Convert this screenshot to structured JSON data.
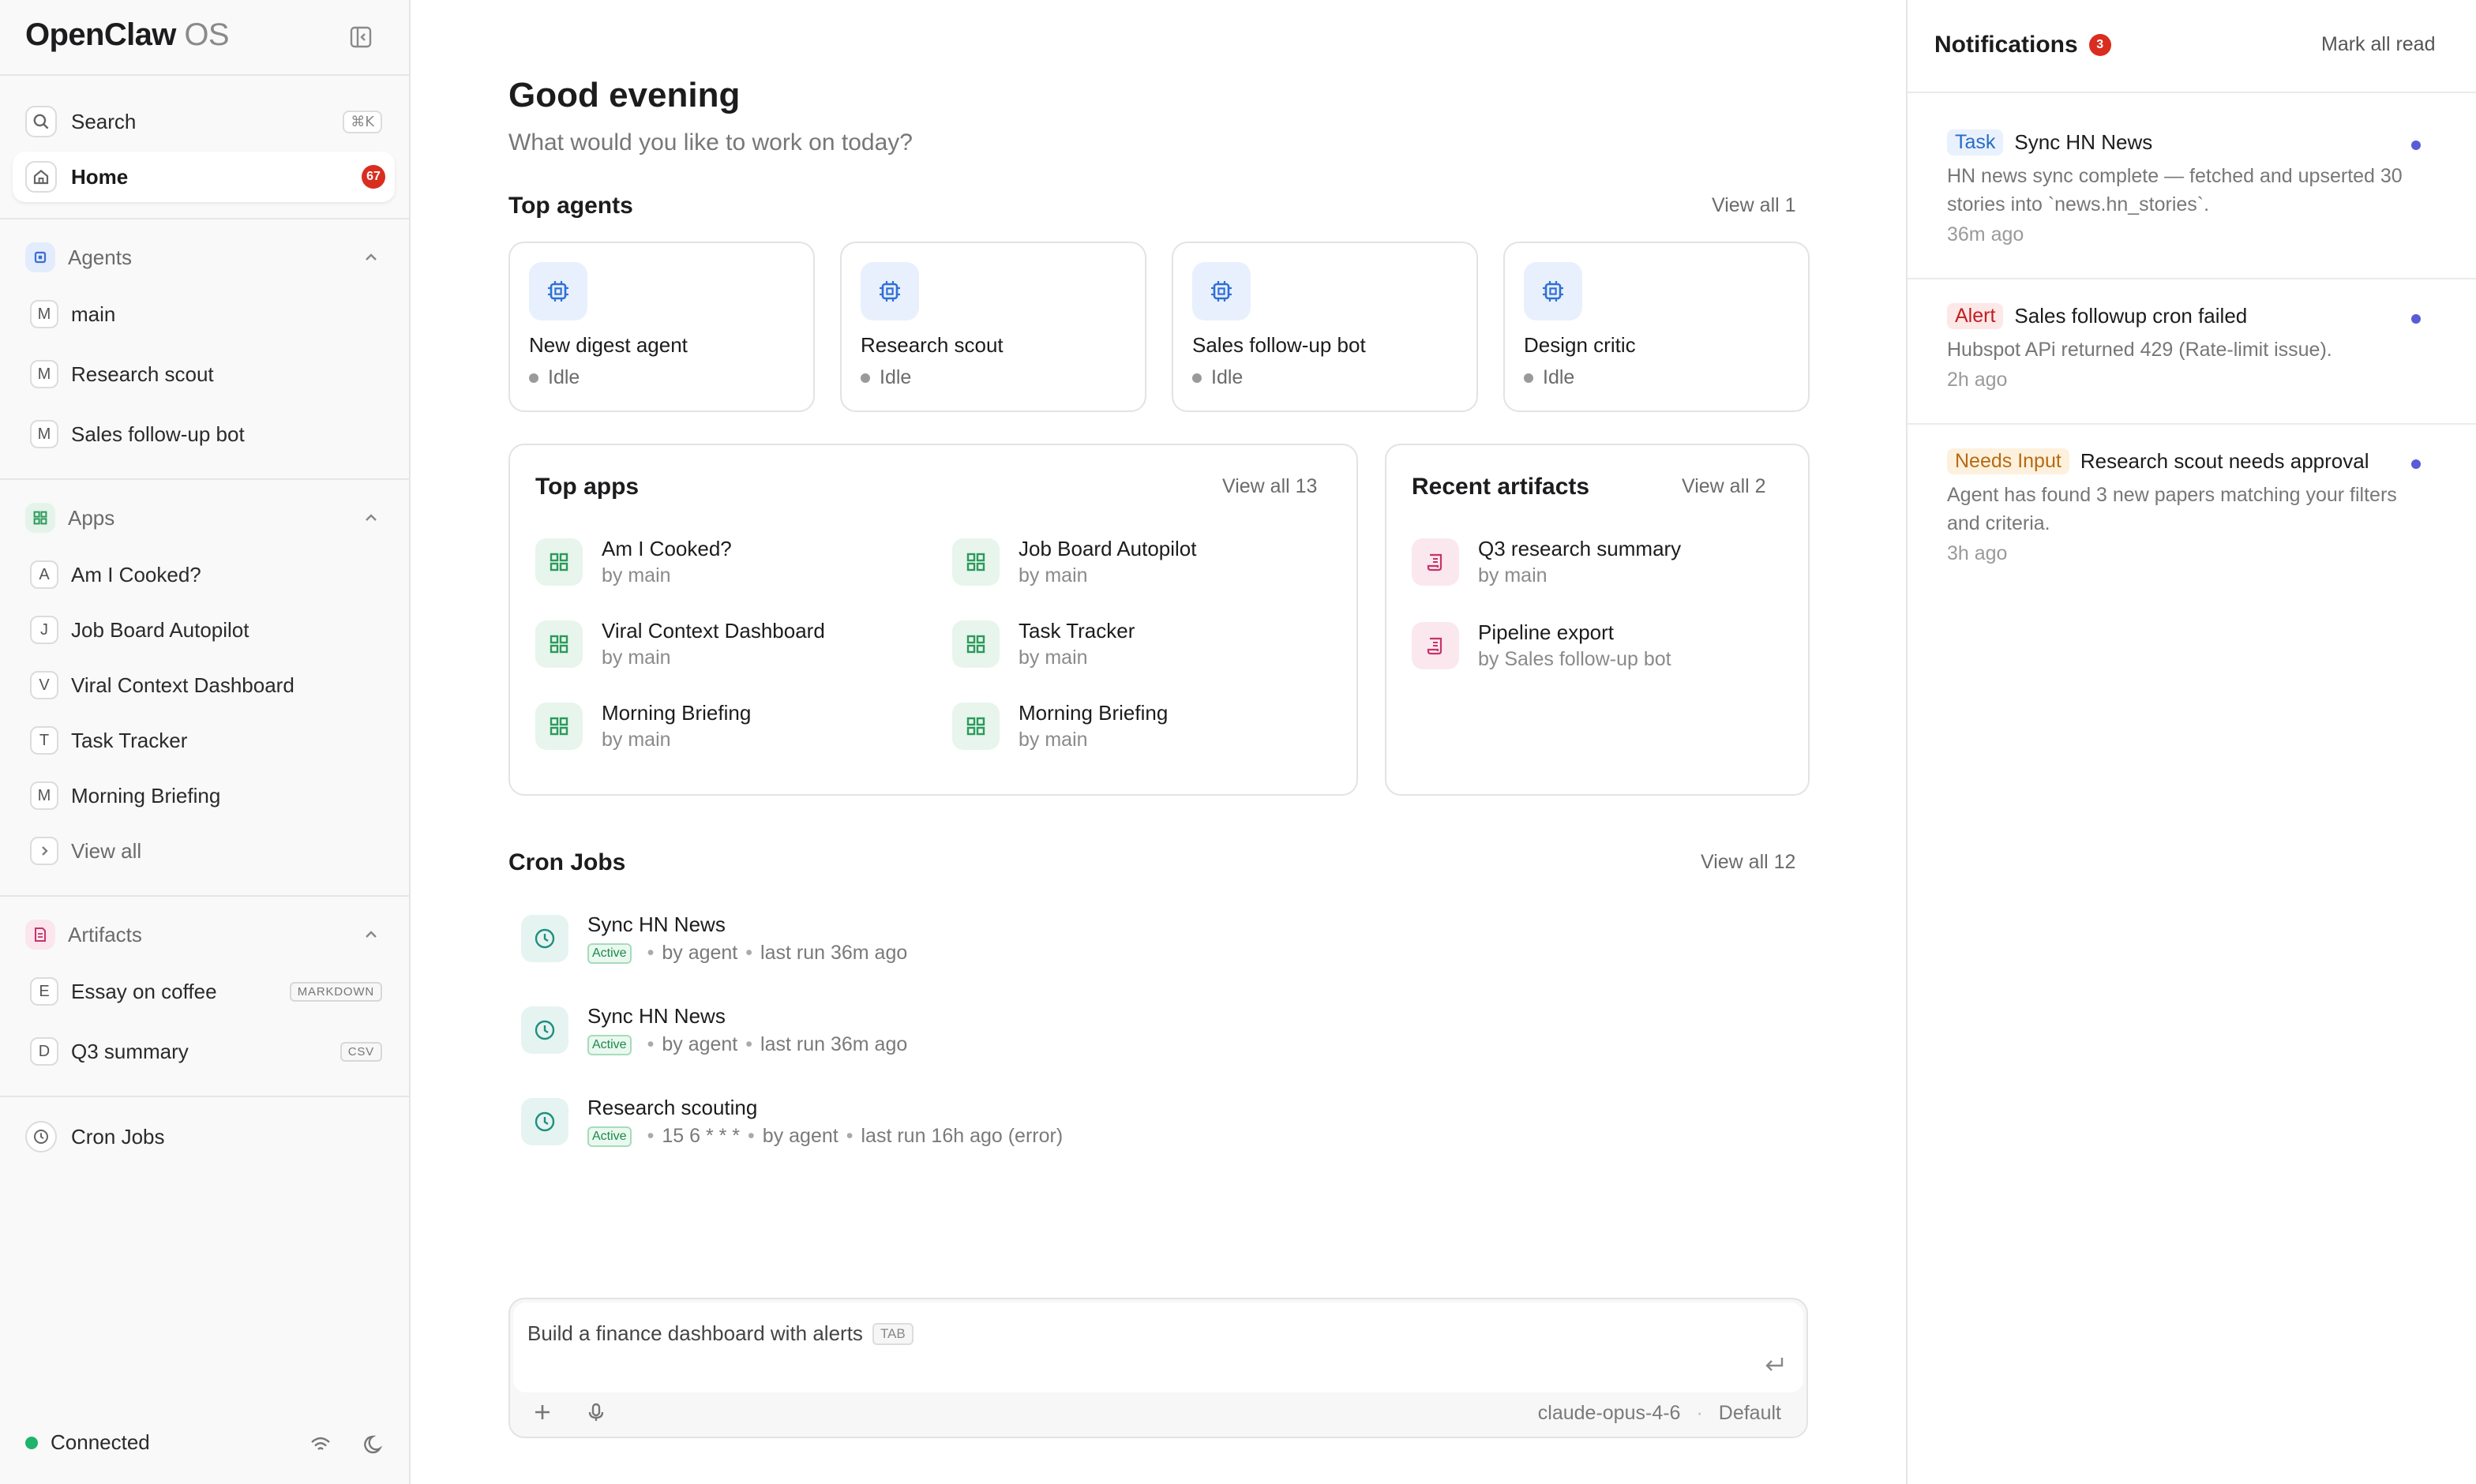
{
  "brand": {
    "name": "OpenClaw",
    "suffix": "OS"
  },
  "sidebar": {
    "search_label": "Search",
    "search_shortcut": "⌘K",
    "home_label": "Home",
    "home_badge": "67",
    "agents_heading": "Agents",
    "agents": [
      {
        "letter": "M",
        "label": "main"
      },
      {
        "letter": "M",
        "label": "Research scout"
      },
      {
        "letter": "M",
        "label": "Sales follow-up bot"
      }
    ],
    "apps_heading": "Apps",
    "apps": [
      {
        "letter": "A",
        "label": "Am I Cooked?"
      },
      {
        "letter": "J",
        "label": "Job Board Autopilot"
      },
      {
        "letter": "V",
        "label": "Viral Context Dashboard"
      },
      {
        "letter": "T",
        "label": "Task Tracker"
      },
      {
        "letter": "M",
        "label": "Morning Briefing"
      }
    ],
    "apps_view_all": "View all",
    "artifacts_heading": "Artifacts",
    "artifacts": [
      {
        "letter": "E",
        "label": "Essay on coffee",
        "tag": "MARKDOWN"
      },
      {
        "letter": "D",
        "label": "Q3 summary",
        "tag": "CSV"
      }
    ],
    "cron_label": "Cron Jobs",
    "status": "Connected"
  },
  "main": {
    "greeting": "Good evening",
    "subgreeting": "What would you like to work on today?",
    "top_agents_title": "Top agents",
    "top_agents_view_all": "View all 1",
    "agents": [
      {
        "name": "New digest agent",
        "status": "Idle"
      },
      {
        "name": "Research scout",
        "status": "Idle"
      },
      {
        "name": "Sales follow-up bot",
        "status": "Idle"
      },
      {
        "name": "Design critic",
        "status": "Idle"
      }
    ],
    "top_apps_title": "Top apps",
    "top_apps_view_all": "View all 13",
    "apps": [
      {
        "name": "Am I Cooked?",
        "by": "by main"
      },
      {
        "name": "Job Board Autopilot",
        "by": "by main"
      },
      {
        "name": "Viral Context Dashboard",
        "by": "by main"
      },
      {
        "name": "Task Tracker",
        "by": "by main"
      },
      {
        "name": "Morning Briefing",
        "by": "by main"
      },
      {
        "name": "Morning Briefing",
        "by": "by main"
      }
    ],
    "artifacts_title": "Recent artifacts",
    "artifacts_view_all": "View all 2",
    "artifacts": [
      {
        "name": "Q3 research summary",
        "by": "by main"
      },
      {
        "name": "Pipeline export",
        "by": "by Sales follow-up bot"
      }
    ],
    "cron_title": "Cron Jobs",
    "cron_view_all": "View all 12",
    "cron_jobs": [
      {
        "name": "Sync HN News",
        "badge": "Active",
        "schedule": "",
        "by": "by agent",
        "last": "last run 36m ago"
      },
      {
        "name": "Sync HN News",
        "badge": "Active",
        "schedule": "",
        "by": "by agent",
        "last": "last run 36m ago"
      },
      {
        "name": "Research scouting",
        "badge": "Active",
        "schedule": "15 6 * * *",
        "by": "by agent",
        "last": "last run 16h ago (error)"
      }
    ],
    "composer": {
      "placeholder": "Build a finance dashboard with alerts",
      "tab_hint": "TAB",
      "model": "claude-opus-4-6",
      "mode": "Default"
    }
  },
  "notifications": {
    "title": "Notifications",
    "count": "3",
    "mark_all_read": "Mark all read",
    "items": [
      {
        "tag": "Task",
        "title": "Sync HN News",
        "body": "HN news sync complete — fetched and upserted 30 stories into `news.hn_stories`.",
        "time": "36m ago"
      },
      {
        "tag": "Alert",
        "title": "Sales followup cron failed",
        "body": "Hubspot APi returned 429 (Rate-limit issue).",
        "time": "2h ago"
      },
      {
        "tag": "Needs Input",
        "title": "Research scout needs approval",
        "body": "Agent has found 3 new papers matching your filters and criteria.",
        "time": "3h ago"
      }
    ]
  },
  "colors": {
    "accent_red": "#d92d20",
    "status_green": "#1fb36b",
    "agent_icon_bg": "#e8f0fd",
    "app_icon_bg": "#e7f5ec",
    "artifact_icon_bg": "#fbe8ef",
    "cron_icon_bg": "#e5f4f1",
    "unread_dot": "#5b5bd6"
  },
  "icons": {
    "search": "search-icon",
    "home": "home-icon",
    "agents": "chip-icon",
    "apps": "grid-icon",
    "artifacts": "document-icon",
    "cron": "clock-icon"
  }
}
